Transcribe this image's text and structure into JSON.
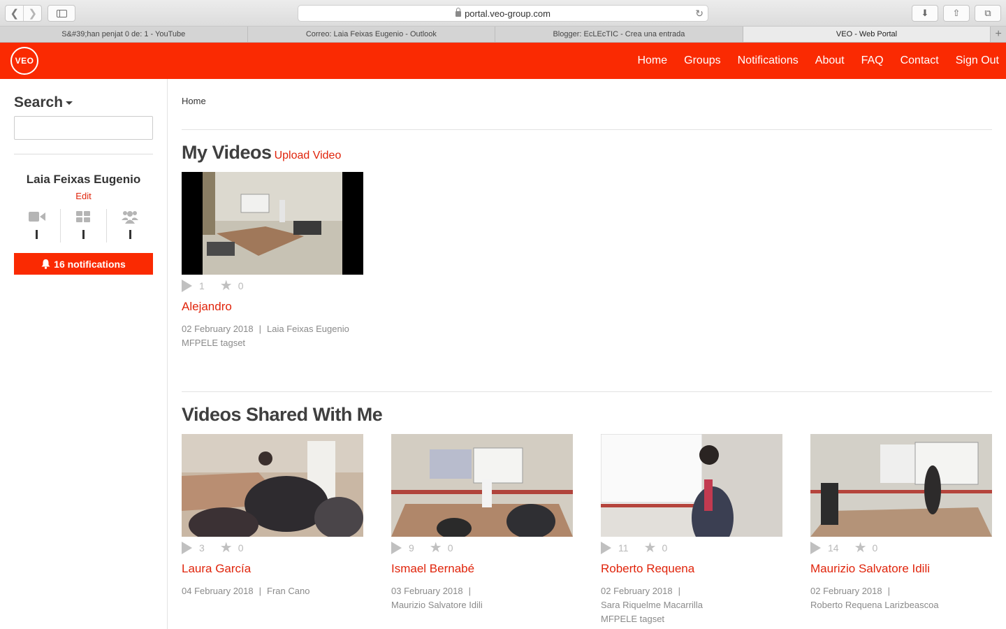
{
  "browser": {
    "url": "portal.veo-group.com",
    "tabs": [
      {
        "label": "S&#39;han penjat 0 de: 1 - YouTube"
      },
      {
        "label": "Correo: Laia Feixas Eugenio - Outlook"
      },
      {
        "label": "Blogger: EcLEcTIC - Crea una entrada"
      },
      {
        "label": "VEO - Web Portal"
      }
    ]
  },
  "header": {
    "logo": "VEO",
    "nav": [
      "Home",
      "Groups",
      "Notifications",
      "About",
      "FAQ",
      "Contact",
      "Sign Out"
    ]
  },
  "sidebar": {
    "search_title": "Search",
    "user_name": "Laia Feixas Eugenio",
    "edit_label": "Edit",
    "stat_icons": [
      "video-camera-icon",
      "grid-icon",
      "users-icon"
    ],
    "notifications_label": "16 notifications"
  },
  "main": {
    "breadcrumb": "Home",
    "my_videos": {
      "title": "My Videos",
      "upload_label": "Upload Video",
      "videos": [
        {
          "title": "Alejandro",
          "views": "1",
          "stars": "0",
          "date": "02 February 2018",
          "separator": "|",
          "author": "Laia Feixas Eugenio",
          "tagset": "MFPELE tagset"
        }
      ]
    },
    "shared": {
      "title": "Videos Shared With Me",
      "videos": [
        {
          "title": "Laura García",
          "views": "3",
          "stars": "0",
          "date": "04 February 2018",
          "separator": "|",
          "author": "Fran Cano",
          "tagset": ""
        },
        {
          "title": "Ismael Bernabé",
          "views": "9",
          "stars": "0",
          "date": "03 February 2018",
          "separator": "|",
          "author": "Maurizio Salvatore Idili",
          "tagset": ""
        },
        {
          "title": "Roberto Requena",
          "views": "11",
          "stars": "0",
          "date": "02 February 2018",
          "separator": "|",
          "author": "Sara Riquelme Macarrilla",
          "tagset": "MFPELE tagset"
        },
        {
          "title": "Maurizio Salvatore Idili",
          "views": "14",
          "stars": "0",
          "date": "02 February 2018",
          "separator": "|",
          "author": "Roberto Requena Larizbeascoa",
          "tagset": ""
        }
      ]
    }
  },
  "colors": {
    "brand_red": "#fa2a02",
    "link_red": "#e0240b"
  }
}
